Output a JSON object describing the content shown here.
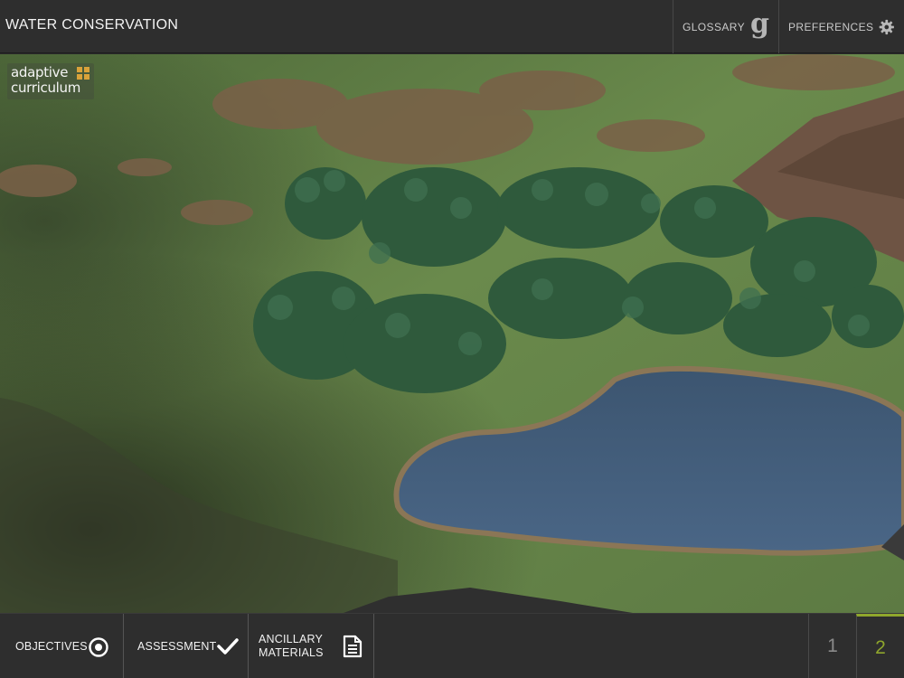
{
  "header": {
    "title": "WATER CONSERVATION",
    "glossary_label": "GLOSSARY",
    "glossary_icon": "g-glossary-icon",
    "preferences_label": "PREFERENCES",
    "preferences_icon": "gear-icon"
  },
  "logo": {
    "line1": "adaptive",
    "line2": "curriculum",
    "accent_color": "#d9a23a"
  },
  "footer": {
    "objectives_label": "OBJECTIVES",
    "objectives_icon": "target-icon",
    "assessment_label": "ASSESSMENT",
    "assessment_icon": "checkmark-icon",
    "ancillary_label_line1": "ANCILLARY",
    "ancillary_label_line2": "MATERIALS",
    "ancillary_icon": "document-icon",
    "pages": [
      "1",
      "2"
    ],
    "active_page": "2",
    "active_color": "#8fa62c"
  }
}
